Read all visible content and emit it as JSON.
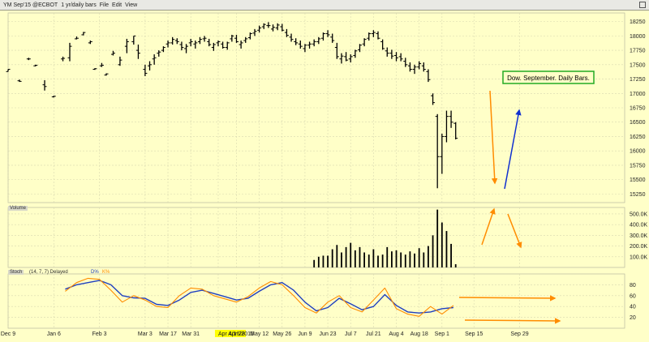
{
  "toolbar": {
    "symbol": "YM Sep'15 @ECBOT",
    "period": "1 yr/daily bars",
    "menu_file": "File",
    "menu_edit": "Edit",
    "menu_view": "View"
  },
  "panels": {
    "volume_label": "Volume",
    "stoch_label": "Stoch",
    "stoch_params": "(14, 7, 7) Delayed",
    "stoch_d_label": "D%",
    "stoch_k_label": "K%"
  },
  "annotation": "Dow. September. Daily Bars.",
  "colors": {
    "background": "#ffffc8",
    "bars": "#000000",
    "annotation_border": "#22aa22",
    "arrow_orange": "#ff8c00",
    "arrow_blue": "#1030d0",
    "stoch_d": "#1f3fbf",
    "stoch_k": "#ff8c00",
    "highlight": "#ffff00"
  },
  "chart_data": [
    {
      "type": "bar",
      "name": "price",
      "ylim": [
        15100,
        18400
      ],
      "yticks": [
        15250,
        15500,
        15750,
        16000,
        16250,
        16500,
        16750,
        17000,
        17250,
        17500,
        17750,
        18000,
        18250
      ],
      "xlim": [
        0,
        270
      ],
      "x_tick_labels": [
        "Dec 9",
        "Jan 6",
        "Feb 3",
        "Mar 3",
        "Mar 17",
        "Mar 31",
        "Apr 4/16/2015",
        "Apr 28",
        "May 12",
        "May 26",
        "Jun 9",
        "Jun 23",
        "Jul 7",
        "Jul 21",
        "Aug 4",
        "Aug 18",
        "Sep 1",
        "Sep 15",
        "Sep 29"
      ],
      "x_tick_pos": [
        0,
        20,
        40,
        60,
        70,
        80,
        92,
        100,
        110,
        120,
        130,
        140,
        150,
        160,
        170,
        180,
        190,
        204,
        224
      ],
      "ohlc": [
        [
          0,
          17380,
          17420,
          17380,
          17420
        ],
        [
          5,
          17220,
          17240,
          17200,
          17210
        ],
        [
          9,
          17600,
          17620,
          17580,
          17600
        ],
        [
          12,
          17480,
          17500,
          17470,
          17490
        ],
        [
          16,
          17150,
          17230,
          17050,
          17120
        ],
        [
          20,
          16940,
          16960,
          16930,
          16950
        ],
        [
          24,
          17600,
          17640,
          17560,
          17610
        ],
        [
          27,
          17620,
          17880,
          17560,
          17820
        ],
        [
          30,
          17950,
          17990,
          17940,
          17960
        ],
        [
          33,
          18020,
          18070,
          18010,
          18060
        ],
        [
          36,
          17880,
          17920,
          17860,
          17900
        ],
        [
          38,
          17420,
          17440,
          17410,
          17430
        ],
        [
          41,
          17480,
          17530,
          17460,
          17490
        ],
        [
          43,
          17320,
          17350,
          17310,
          17340
        ],
        [
          46,
          17680,
          17740,
          17660,
          17700
        ],
        [
          49,
          17500,
          17640,
          17480,
          17580
        ],
        [
          52,
          17820,
          17950,
          17700,
          17900
        ],
        [
          55,
          17900,
          18000,
          17850,
          18000
        ],
        [
          57,
          17750,
          17850,
          17600,
          17700
        ],
        [
          60,
          17420,
          17500,
          17300,
          17350
        ],
        [
          62,
          17480,
          17560,
          17400,
          17500
        ],
        [
          64,
          17600,
          17680,
          17500,
          17620
        ],
        [
          66,
          17700,
          17750,
          17640,
          17720
        ],
        [
          68,
          17750,
          17820,
          17720,
          17800
        ],
        [
          70,
          17860,
          17920,
          17800,
          17880
        ],
        [
          72,
          17880,
          17980,
          17850,
          17940
        ],
        [
          74,
          17920,
          17960,
          17860,
          17900
        ],
        [
          76,
          17850,
          17900,
          17750,
          17800
        ],
        [
          78,
          17780,
          17860,
          17700,
          17820
        ],
        [
          80,
          17880,
          17950,
          17820,
          17900
        ],
        [
          82,
          17860,
          17920,
          17780,
          17880
        ],
        [
          84,
          17900,
          17980,
          17860,
          17940
        ],
        [
          86,
          17950,
          18000,
          17900,
          17960
        ],
        [
          88,
          17900,
          17950,
          17820,
          17850
        ],
        [
          90,
          17800,
          17880,
          17740,
          17850
        ],
        [
          92,
          17880,
          17920,
          17820,
          17900
        ],
        [
          94,
          17860,
          17900,
          17780,
          17800
        ],
        [
          96,
          17800,
          17900,
          17760,
          17880
        ],
        [
          98,
          17950,
          18020,
          17900,
          18000
        ],
        [
          100,
          17960,
          18020,
          17880,
          17900
        ],
        [
          102,
          17850,
          17920,
          17780,
          17880
        ],
        [
          104,
          17920,
          17980,
          17880,
          17950
        ],
        [
          106,
          17970,
          18060,
          17940,
          18040
        ],
        [
          108,
          18050,
          18120,
          18000,
          18080
        ],
        [
          110,
          18100,
          18180,
          18060,
          18140
        ],
        [
          112,
          18160,
          18220,
          18120,
          18200
        ],
        [
          114,
          18180,
          18240,
          18140,
          18180
        ],
        [
          116,
          18120,
          18200,
          18080,
          18150
        ],
        [
          118,
          18140,
          18220,
          18100,
          18190
        ],
        [
          120,
          18160,
          18210,
          18080,
          18100
        ],
        [
          122,
          18060,
          18120,
          17980,
          18010
        ],
        [
          124,
          17980,
          18040,
          17900,
          17940
        ],
        [
          126,
          17900,
          17960,
          17840,
          17880
        ],
        [
          128,
          17860,
          17920,
          17780,
          17820
        ],
        [
          130,
          17780,
          17860,
          17720,
          17840
        ],
        [
          132,
          17840,
          17900,
          17780,
          17860
        ],
        [
          134,
          17860,
          17940,
          17820,
          17900
        ],
        [
          136,
          17900,
          17980,
          17860,
          17950
        ],
        [
          138,
          17960,
          18060,
          17920,
          18040
        ],
        [
          140,
          18040,
          18100,
          17980,
          18020
        ],
        [
          142,
          17980,
          18040,
          17880,
          17920
        ],
        [
          144,
          17800,
          17880,
          17600,
          17640
        ],
        [
          146,
          17600,
          17700,
          17520,
          17650
        ],
        [
          148,
          17640,
          17720,
          17560,
          17580
        ],
        [
          150,
          17600,
          17680,
          17540,
          17640
        ],
        [
          152,
          17660,
          17760,
          17620,
          17740
        ],
        [
          154,
          17760,
          17860,
          17720,
          17840
        ],
        [
          156,
          17860,
          17960,
          17820,
          17940
        ],
        [
          158,
          17960,
          18060,
          17920,
          18040
        ],
        [
          160,
          18040,
          18100,
          17980,
          18060
        ],
        [
          162,
          18040,
          18080,
          17940,
          17960
        ],
        [
          164,
          17900,
          17940,
          17760,
          17780
        ],
        [
          166,
          17740,
          17800,
          17640,
          17700
        ],
        [
          168,
          17700,
          17760,
          17600,
          17650
        ],
        [
          170,
          17660,
          17720,
          17560,
          17620
        ],
        [
          172,
          17640,
          17700,
          17560,
          17600
        ],
        [
          174,
          17560,
          17620,
          17460,
          17500
        ],
        [
          176,
          17480,
          17540,
          17380,
          17420
        ],
        [
          178,
          17420,
          17500,
          17340,
          17460
        ],
        [
          180,
          17460,
          17560,
          17420,
          17520
        ],
        [
          182,
          17480,
          17540,
          17380,
          17420
        ],
        [
          184,
          17380,
          17420,
          17200,
          17240
        ],
        [
          186,
          16960,
          17000,
          16800,
          16840
        ],
        [
          188,
          16600,
          16640,
          15350,
          15900
        ],
        [
          190,
          15900,
          16300,
          15600,
          16250
        ],
        [
          192,
          16250,
          16700,
          16150,
          16600
        ],
        [
          194,
          16600,
          16700,
          16400,
          16500
        ],
        [
          196,
          16480,
          16500,
          16200,
          16220
        ]
      ]
    },
    {
      "type": "bar",
      "name": "volume",
      "ylim": [
        0,
        560000
      ],
      "yticks": [
        100000,
        200000,
        300000,
        400000,
        500000
      ],
      "ytick_labels": [
        "100.0K",
        "200.0K",
        "300.0K",
        "400.0K",
        "500.0K"
      ],
      "x": [
        134,
        136,
        138,
        140,
        142,
        144,
        146,
        148,
        150,
        152,
        154,
        156,
        158,
        160,
        162,
        164,
        166,
        168,
        170,
        172,
        174,
        176,
        178,
        180,
        182,
        184,
        186,
        188,
        190,
        192,
        194,
        196
      ],
      "values": [
        70000,
        100000,
        110000,
        110000,
        170000,
        210000,
        140000,
        190000,
        230000,
        160000,
        190000,
        140000,
        120000,
        170000,
        110000,
        120000,
        190000,
        150000,
        160000,
        140000,
        120000,
        150000,
        130000,
        180000,
        140000,
        200000,
        300000,
        540000,
        420000,
        340000,
        220000,
        30000
      ]
    },
    {
      "type": "line",
      "name": "stochastic",
      "ylim": [
        0,
        100
      ],
      "yticks": [
        20,
        40,
        60,
        80
      ],
      "series": [
        {
          "name": "D%",
          "x": [
            25,
            30,
            35,
            40,
            45,
            50,
            55,
            60,
            65,
            70,
            75,
            80,
            85,
            90,
            95,
            100,
            105,
            110,
            115,
            120,
            125,
            130,
            135,
            140,
            145,
            150,
            155,
            160,
            165,
            170,
            175,
            180,
            185,
            190,
            195
          ],
          "values": [
            72,
            80,
            84,
            88,
            80,
            60,
            56,
            55,
            44,
            42,
            52,
            66,
            70,
            64,
            58,
            52,
            55,
            68,
            80,
            84,
            70,
            48,
            32,
            38,
            55,
            45,
            34,
            40,
            62,
            42,
            30,
            28,
            30,
            36,
            38
          ]
        },
        {
          "name": "K%",
          "x": [
            25,
            30,
            35,
            40,
            45,
            50,
            55,
            60,
            65,
            70,
            75,
            80,
            85,
            90,
            95,
            100,
            105,
            110,
            115,
            120,
            125,
            130,
            135,
            140,
            145,
            150,
            155,
            160,
            165,
            170,
            175,
            180,
            185,
            190,
            195
          ],
          "values": [
            68,
            84,
            92,
            90,
            70,
            48,
            60,
            52,
            40,
            38,
            60,
            74,
            72,
            60,
            54,
            48,
            58,
            74,
            86,
            80,
            60,
            38,
            28,
            48,
            60,
            38,
            30,
            52,
            74,
            36,
            26,
            22,
            40,
            26,
            42
          ]
        }
      ]
    }
  ]
}
